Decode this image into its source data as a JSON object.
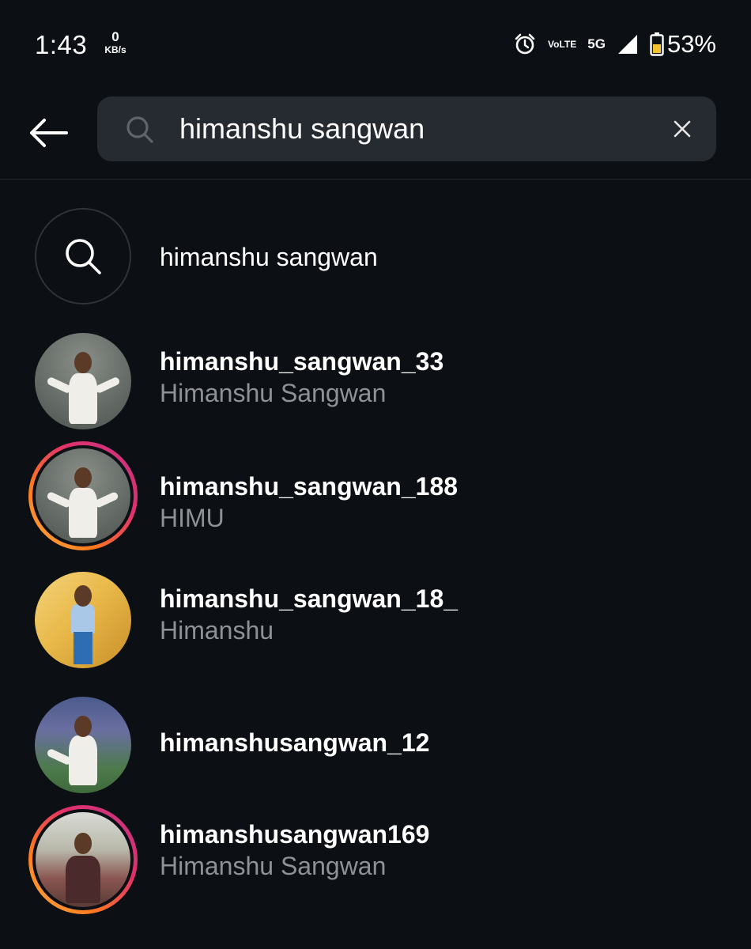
{
  "status_bar": {
    "time": "1:43",
    "net_speed_value": "0",
    "net_speed_unit": "KB/s",
    "volte_top": "Vo",
    "volte_bottom": "LTE",
    "network_type": "5G",
    "battery_percent": "53%",
    "icons": [
      "alarm-icon",
      "volte-icon",
      "5g-icon",
      "signal-icon",
      "battery-icon"
    ]
  },
  "search": {
    "query": "himanshu sangwan",
    "placeholder": "Search"
  },
  "results": [
    {
      "kind": "keyword",
      "primary": "himanshu sangwan",
      "secondary": "",
      "icon": "search-icon"
    },
    {
      "kind": "account",
      "primary": "himanshu_sangwan_33",
      "secondary": "Himanshu Sangwan",
      "has_story": false
    },
    {
      "kind": "account",
      "primary": "himanshu_sangwan_188",
      "secondary": "HIMU",
      "has_story": true
    },
    {
      "kind": "account",
      "primary": "himanshu_sangwan_18_",
      "secondary": "Himanshu",
      "has_story": false
    },
    {
      "kind": "account",
      "primary": "himanshusangwan_12",
      "secondary": "",
      "has_story": false
    },
    {
      "kind": "account",
      "primary": "himanshusangwan169",
      "secondary": "Himanshu Sangwan",
      "has_story": true
    }
  ],
  "colors": {
    "background": "#0c0f14",
    "search_field": "#262a31",
    "secondary_text": "#8e9196",
    "story_ring_start": "#fcb045",
    "story_ring_end": "#c13584"
  }
}
